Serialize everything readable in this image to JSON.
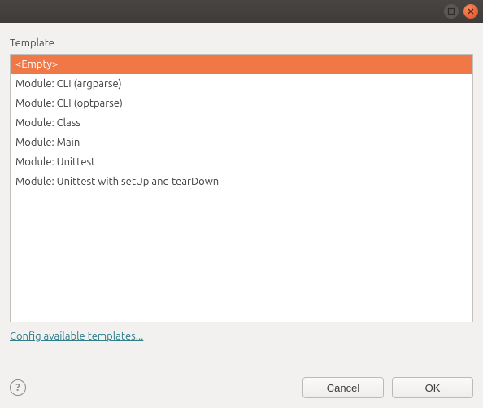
{
  "window": {
    "title": ""
  },
  "label": "Template",
  "templates": {
    "items": [
      "<Empty>",
      "Module: CLI (argparse)",
      "Module: CLI (optparse)",
      "Module: Class",
      "Module: Main",
      "Module: Unittest",
      "Module: Unittest with setUp and tearDown"
    ],
    "selected_index": 0
  },
  "link": {
    "config_templates": "Config available templates..."
  },
  "footer": {
    "help_glyph": "?",
    "cancel": "Cancel",
    "ok": "OK"
  },
  "colors": {
    "selection": "#f07746",
    "link": "#2e7e8b",
    "close_button": "#e9653b"
  }
}
